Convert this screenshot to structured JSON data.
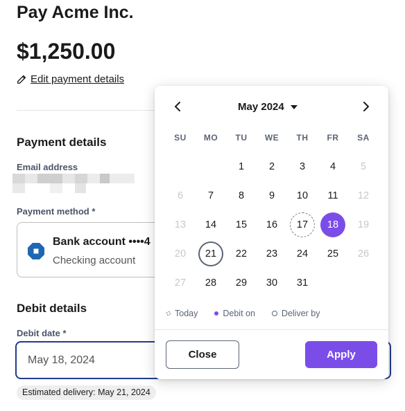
{
  "header": {
    "title": "Pay Acme Inc.",
    "amount": "$1,250.00",
    "edit_link": "Edit payment details"
  },
  "payment_details": {
    "heading": "Payment details",
    "email_label": "Email address",
    "method_label": "Payment method *",
    "method_name": "Bank account ••••4",
    "method_type": "Checking account"
  },
  "debit_details": {
    "heading": "Debit details",
    "date_label": "Debit date *",
    "date_value": "May 18, 2024",
    "estimated_delivery": "Estimated delivery: May 21, 2024"
  },
  "calendar": {
    "month_label": "May 2024",
    "weekdays": [
      "SU",
      "MO",
      "TU",
      "WE",
      "TH",
      "FR",
      "SA"
    ],
    "days": [
      {
        "n": "1",
        "col": 2,
        "row": 0
      },
      {
        "n": "2",
        "col": 3,
        "row": 0
      },
      {
        "n": "3",
        "col": 4,
        "row": 0
      },
      {
        "n": "4",
        "col": 5,
        "row": 0
      },
      {
        "n": "5",
        "col": 6,
        "row": 0,
        "muted": true
      },
      {
        "n": "6",
        "col": 0,
        "row": 1,
        "muted": true
      },
      {
        "n": "7",
        "col": 1,
        "row": 1
      },
      {
        "n": "8",
        "col": 2,
        "row": 1
      },
      {
        "n": "9",
        "col": 3,
        "row": 1
      },
      {
        "n": "10",
        "col": 4,
        "row": 1
      },
      {
        "n": "11",
        "col": 5,
        "row": 1
      },
      {
        "n": "12",
        "col": 6,
        "row": 1,
        "muted": true
      },
      {
        "n": "13",
        "col": 0,
        "row": 2,
        "muted": true
      },
      {
        "n": "14",
        "col": 1,
        "row": 2
      },
      {
        "n": "15",
        "col": 2,
        "row": 2
      },
      {
        "n": "16",
        "col": 3,
        "row": 2
      },
      {
        "n": "17",
        "col": 4,
        "row": 2,
        "state": "today"
      },
      {
        "n": "18",
        "col": 5,
        "row": 2,
        "state": "debit"
      },
      {
        "n": "19",
        "col": 6,
        "row": 2,
        "muted": true
      },
      {
        "n": "20",
        "col": 0,
        "row": 3,
        "muted": true
      },
      {
        "n": "21",
        "col": 1,
        "row": 3,
        "state": "deliver"
      },
      {
        "n": "22",
        "col": 2,
        "row": 3
      },
      {
        "n": "23",
        "col": 3,
        "row": 3
      },
      {
        "n": "24",
        "col": 4,
        "row": 3
      },
      {
        "n": "25",
        "col": 5,
        "row": 3
      },
      {
        "n": "26",
        "col": 6,
        "row": 3,
        "muted": true
      },
      {
        "n": "27",
        "col": 0,
        "row": 4,
        "muted": true
      },
      {
        "n": "28",
        "col": 1,
        "row": 4
      },
      {
        "n": "29",
        "col": 2,
        "row": 4
      },
      {
        "n": "30",
        "col": 3,
        "row": 4
      },
      {
        "n": "31",
        "col": 4,
        "row": 4
      }
    ],
    "legend": {
      "today": "Today",
      "debit": "Debit on",
      "deliver": "Deliver by"
    },
    "close_label": "Close",
    "apply_label": "Apply"
  },
  "colors": {
    "accent": "#7b4de8",
    "input_focus": "#1f3b8c",
    "muted_text": "#5a6475"
  },
  "icons": {
    "edit": "pencil-icon",
    "bank": "bank-logo-icon",
    "prev": "chevron-left-icon",
    "next": "chevron-right-icon",
    "month_dropdown": "caret-down-icon"
  }
}
